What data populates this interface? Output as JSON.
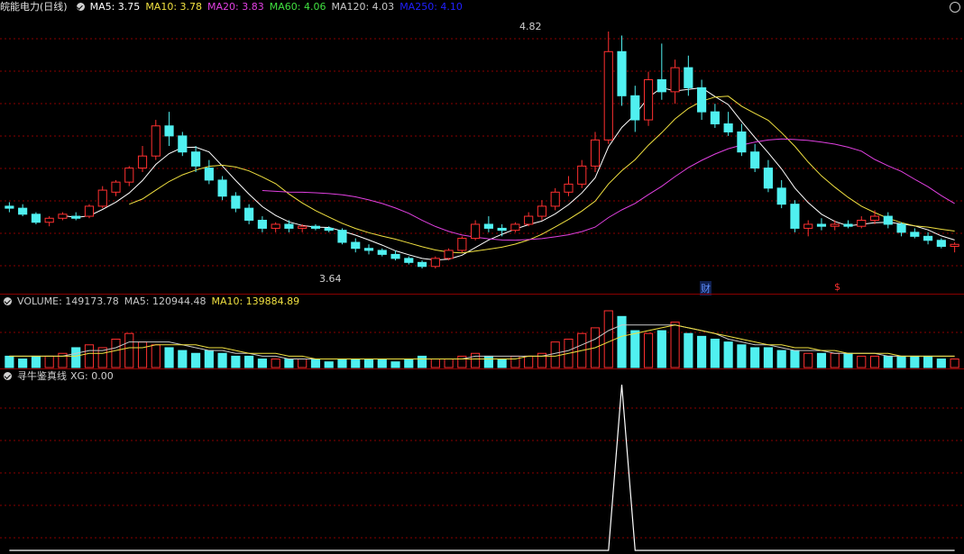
{
  "main_pane": {
    "title": "皖能电力(日线)",
    "indicators": [
      {
        "label": "MA5: 3.75",
        "color": "#ffffff"
      },
      {
        "label": "MA10: 3.78",
        "color": "#f0e040"
      },
      {
        "label": "MA20: 3.83",
        "color": "#e040e0"
      },
      {
        "label": "MA60: 4.06",
        "color": "#40e040"
      },
      {
        "label": "MA120: 4.03",
        "color": "#c8c8c8"
      },
      {
        "label": "MA250: 4.10",
        "color": "#2020ff"
      }
    ],
    "high_label": "4.82",
    "low_label": "3.64",
    "marker_cai": "财",
    "marker_s": "$"
  },
  "volume_pane": {
    "indicators": [
      {
        "label": "VOLUME: 149173.78",
        "color": "#c8c8c8"
      },
      {
        "label": "MA5: 120944.48",
        "color": "#c8c8c8"
      },
      {
        "label": "MA10: 139884.89",
        "color": "#f0e040"
      }
    ]
  },
  "signal_pane": {
    "title": "寻牛鉴真线",
    "indicator": "XG: 0.00"
  },
  "chart_data": {
    "type": "candlestick",
    "high": 4.82,
    "low": 3.64,
    "colors": {
      "up": "#ff3030",
      "down": "#50f0f0",
      "grid": "#8a0000"
    },
    "candles": [
      [
        3.95,
        3.97,
        3.92,
        3.94
      ],
      [
        3.94,
        3.96,
        3.9,
        3.91
      ],
      [
        3.91,
        3.92,
        3.86,
        3.87
      ],
      [
        3.87,
        3.9,
        3.85,
        3.89
      ],
      [
        3.89,
        3.92,
        3.88,
        3.91
      ],
      [
        3.9,
        3.92,
        3.88,
        3.89
      ],
      [
        3.9,
        3.96,
        3.89,
        3.95
      ],
      [
        3.95,
        4.05,
        3.94,
        4.03
      ],
      [
        4.02,
        4.08,
        4.0,
        4.07
      ],
      [
        4.07,
        4.15,
        4.05,
        4.14
      ],
      [
        4.14,
        4.25,
        4.12,
        4.2
      ],
      [
        4.2,
        4.38,
        4.18,
        4.35
      ],
      [
        4.35,
        4.42,
        4.25,
        4.3
      ],
      [
        4.3,
        4.32,
        4.2,
        4.22
      ],
      [
        4.22,
        4.25,
        4.12,
        4.15
      ],
      [
        4.14,
        4.18,
        4.06,
        4.08
      ],
      [
        4.08,
        4.1,
        3.98,
        4.0
      ],
      [
        4.0,
        4.02,
        3.92,
        3.94
      ],
      [
        3.94,
        3.96,
        3.86,
        3.88
      ],
      [
        3.88,
        3.9,
        3.82,
        3.84
      ],
      [
        3.84,
        3.87,
        3.82,
        3.86
      ],
      [
        3.86,
        3.88,
        3.82,
        3.84
      ],
      [
        3.84,
        3.86,
        3.82,
        3.85
      ],
      [
        3.85,
        3.86,
        3.83,
        3.84
      ],
      [
        3.84,
        3.85,
        3.82,
        3.83
      ],
      [
        3.83,
        3.84,
        3.76,
        3.77
      ],
      [
        3.77,
        3.79,
        3.72,
        3.74
      ],
      [
        3.74,
        3.76,
        3.71,
        3.73
      ],
      [
        3.73,
        3.74,
        3.7,
        3.71
      ],
      [
        3.71,
        3.73,
        3.68,
        3.69
      ],
      [
        3.69,
        3.7,
        3.66,
        3.67
      ],
      [
        3.67,
        3.68,
        3.64,
        3.65
      ],
      [
        3.65,
        3.7,
        3.64,
        3.69
      ],
      [
        3.69,
        3.74,
        3.68,
        3.73
      ],
      [
        3.73,
        3.8,
        3.72,
        3.79
      ],
      [
        3.79,
        3.88,
        3.78,
        3.86
      ],
      [
        3.86,
        3.9,
        3.82,
        3.84
      ],
      [
        3.84,
        3.86,
        3.8,
        3.83
      ],
      [
        3.83,
        3.87,
        3.82,
        3.86
      ],
      [
        3.86,
        3.92,
        3.85,
        3.9
      ],
      [
        3.9,
        3.98,
        3.88,
        3.95
      ],
      [
        3.95,
        4.04,
        3.93,
        4.02
      ],
      [
        4.02,
        4.1,
        4.0,
        4.06
      ],
      [
        4.06,
        4.18,
        4.04,
        4.15
      ],
      [
        4.15,
        4.32,
        4.12,
        4.28
      ],
      [
        4.28,
        4.82,
        4.26,
        4.72
      ],
      [
        4.72,
        4.8,
        4.45,
        4.5
      ],
      [
        4.5,
        4.55,
        4.32,
        4.38
      ],
      [
        4.38,
        4.62,
        4.35,
        4.58
      ],
      [
        4.58,
        4.76,
        4.48,
        4.52
      ],
      [
        4.52,
        4.68,
        4.46,
        4.64
      ],
      [
        4.64,
        4.7,
        4.5,
        4.54
      ],
      [
        4.54,
        4.58,
        4.38,
        4.42
      ],
      [
        4.42,
        4.46,
        4.34,
        4.36
      ],
      [
        4.36,
        4.42,
        4.3,
        4.32
      ],
      [
        4.32,
        4.36,
        4.2,
        4.22
      ],
      [
        4.22,
        4.26,
        4.12,
        4.14
      ],
      [
        4.14,
        4.18,
        4.02,
        4.04
      ],
      [
        4.04,
        4.08,
        3.94,
        3.96
      ],
      [
        3.96,
        3.98,
        3.82,
        3.84
      ],
      [
        3.84,
        3.88,
        3.8,
        3.86
      ],
      [
        3.86,
        3.89,
        3.83,
        3.85
      ],
      [
        3.85,
        3.88,
        3.83,
        3.86
      ],
      [
        3.86,
        3.88,
        3.84,
        3.85
      ],
      [
        3.85,
        3.9,
        3.84,
        3.88
      ],
      [
        3.88,
        3.93,
        3.86,
        3.9
      ],
      [
        3.9,
        3.92,
        3.84,
        3.86
      ],
      [
        3.86,
        3.87,
        3.8,
        3.82
      ],
      [
        3.82,
        3.84,
        3.79,
        3.8
      ],
      [
        3.8,
        3.82,
        3.76,
        3.78
      ],
      [
        3.78,
        3.79,
        3.74,
        3.75
      ],
      [
        3.75,
        3.77,
        3.72,
        3.76
      ]
    ],
    "volume": [
      4,
      3,
      4,
      4,
      5,
      7,
      8,
      7,
      10,
      12,
      9,
      8,
      7,
      6,
      5,
      6,
      5,
      4,
      4,
      3,
      3,
      3,
      3,
      3,
      2,
      3,
      3,
      3,
      3,
      2,
      3,
      4,
      3,
      3,
      4,
      5,
      4,
      3,
      4,
      4,
      5,
      9,
      10,
      12,
      14,
      20,
      18,
      13,
      12,
      13,
      16,
      12,
      11,
      10,
      9,
      8,
      7,
      7,
      6,
      6,
      5,
      5,
      5,
      5,
      4,
      4,
      4,
      4,
      4,
      4,
      3,
      3
    ],
    "volume_ma5": [
      4,
      4,
      4,
      4,
      4,
      5,
      6,
      6,
      7,
      9,
      9,
      9,
      9,
      8,
      7,
      6,
      6,
      5,
      5,
      4,
      4,
      3,
      3,
      3,
      3,
      3,
      3,
      3,
      3,
      3,
      3,
      3,
      3,
      3,
      3,
      4,
      4,
      4,
      4,
      4,
      4,
      5,
      6,
      8,
      10,
      13,
      15,
      15,
      15,
      15,
      15,
      14,
      13,
      12,
      10,
      9,
      8,
      8,
      7,
      6,
      6,
      6,
      5,
      5,
      5,
      5,
      4,
      4,
      4,
      4,
      4,
      4
    ],
    "volume_ma10": [
      4,
      4,
      4,
      4,
      4,
      4,
      5,
      5,
      6,
      7,
      7,
      8,
      8,
      8,
      8,
      7,
      7,
      6,
      5,
      5,
      5,
      4,
      4,
      3,
      3,
      3,
      3,
      3,
      3,
      3,
      3,
      3,
      3,
      3,
      3,
      3,
      3,
      3,
      3,
      4,
      4,
      4,
      5,
      6,
      7,
      9,
      11,
      12,
      13,
      14,
      15,
      14,
      13,
      12,
      11,
      10,
      9,
      8,
      8,
      7,
      7,
      6,
      6,
      5,
      5,
      5,
      5,
      4,
      4,
      4,
      4,
      4
    ],
    "signal": [
      0,
      0,
      0,
      0,
      0,
      0,
      0,
      0,
      0,
      0,
      0,
      0,
      0,
      0,
      0,
      0,
      0,
      0,
      0,
      0,
      0,
      0,
      0,
      0,
      0,
      0,
      0,
      0,
      0,
      0,
      0,
      0,
      0,
      0,
      0,
      0,
      0,
      0,
      0,
      0,
      0,
      0,
      0,
      0,
      0,
      0,
      1,
      0,
      0,
      0,
      0,
      0,
      0,
      0,
      0,
      0,
      0,
      0,
      0,
      0,
      0,
      0,
      0,
      0,
      0,
      0,
      0,
      0,
      0,
      0,
      0,
      0
    ]
  }
}
